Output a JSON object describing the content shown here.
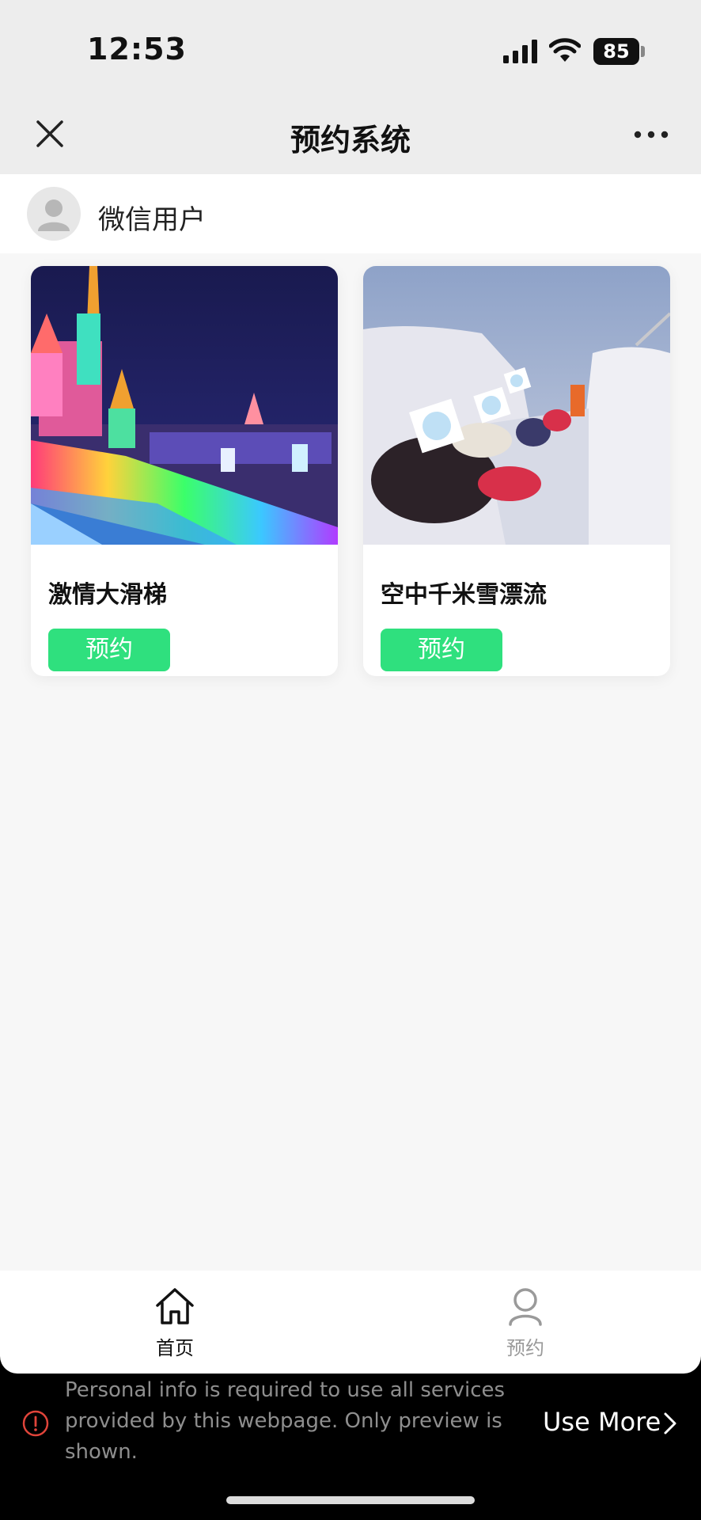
{
  "status_bar": {
    "time": "12:53",
    "battery": "85"
  },
  "nav": {
    "title": "预约系统"
  },
  "user": {
    "name": "微信用户"
  },
  "items": [
    {
      "title": "激情大滑梯",
      "button": "预约",
      "image": "night illuminated ice castle with rainbow slide"
    },
    {
      "title": "空中千米雪漂流",
      "button": "预约",
      "image": "people on snow tubes in ice chute"
    }
  ],
  "tabs": [
    {
      "label": "首页",
      "icon": "home-icon",
      "active": true
    },
    {
      "label": "预约",
      "icon": "person-icon",
      "active": false
    }
  ],
  "banner": {
    "text": "Personal info is required to use all services provided by this webpage. Only preview is shown.",
    "action": "Use More"
  },
  "colors": {
    "accent": "#2fe07e",
    "nav_bg": "#ededed",
    "banner_bg": "#000000"
  }
}
